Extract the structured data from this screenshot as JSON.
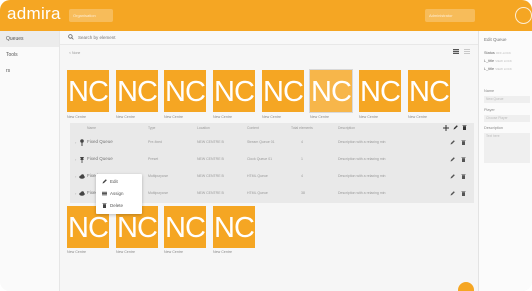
{
  "app": {
    "logo": "admira",
    "accent": "#f5a623"
  },
  "topbar": {
    "pill_left": "Organisation",
    "pill_right": "Administrator"
  },
  "sidebar": {
    "items": [
      {
        "label": "Queues",
        "active": true
      },
      {
        "label": "Tools",
        "active": false
      },
      {
        "label": "rs",
        "active": false
      }
    ]
  },
  "search": {
    "placeholder": "Search by element"
  },
  "breadcrumb": "< None",
  "tiles_top": [
    {
      "text": "NC",
      "label": "New Centre"
    },
    {
      "text": "NC",
      "label": "New Centre"
    },
    {
      "text": "NC",
      "label": "New Centre"
    },
    {
      "text": "NC",
      "label": "New Centre"
    },
    {
      "text": "NC",
      "label": "New Centre"
    },
    {
      "text": "NC",
      "label": "New Centre"
    },
    {
      "text": "NC",
      "label": "New Centre"
    },
    {
      "text": "NC",
      "label": "New Centre"
    }
  ],
  "tiles_bottom": [
    {
      "text": "NC",
      "label": "New Centre"
    },
    {
      "text": "NC",
      "label": "New Centre"
    },
    {
      "text": "NC",
      "label": "New Centre"
    },
    {
      "text": "NC",
      "label": "New Centre"
    }
  ],
  "table": {
    "headers": [
      "Name",
      "Type",
      "Location",
      "Content",
      "Total elements",
      "Description"
    ],
    "rows": [
      {
        "name": "Fixed Queue",
        "type": "Pre-fixed",
        "location": "NEW CENTRE B",
        "content": "Stream Queue 01",
        "total": "4",
        "description": "Description with a relaxing min"
      },
      {
        "name": "Fixed Queue",
        "type": "Preset",
        "location": "NEW CENTRE B",
        "content": "Clock Queue 01",
        "total": "1",
        "description": "Description with a relaxing min"
      },
      {
        "name": "Fixed",
        "type": "Multipurpose",
        "location": "NEW CENTRE B",
        "content": "HTML Queue",
        "total": "4",
        "description": "Description with a relaxing min"
      },
      {
        "name": "Fixed",
        "type": "Multipurpose",
        "location": "NEW CENTRE B",
        "content": "HTML Queue",
        "total": "38",
        "description": "Description with a relaxing min"
      }
    ]
  },
  "context_menu": {
    "items": [
      "Edit",
      "Assign",
      "Delete"
    ]
  },
  "panel": {
    "title": "Edit Queue",
    "status_label": "Status",
    "status_value": "OFF-LOCK",
    "l_title": "L_title",
    "l_title_value": "VIEW LOCK",
    "l_title2": "L_title",
    "l_title2_value": "VIEW LOCK",
    "name_label": "Name",
    "name_value": "New Queue",
    "player_label": "Player",
    "player_value": "Choose Player",
    "desc_label": "Description",
    "desc_value": "Text here"
  }
}
